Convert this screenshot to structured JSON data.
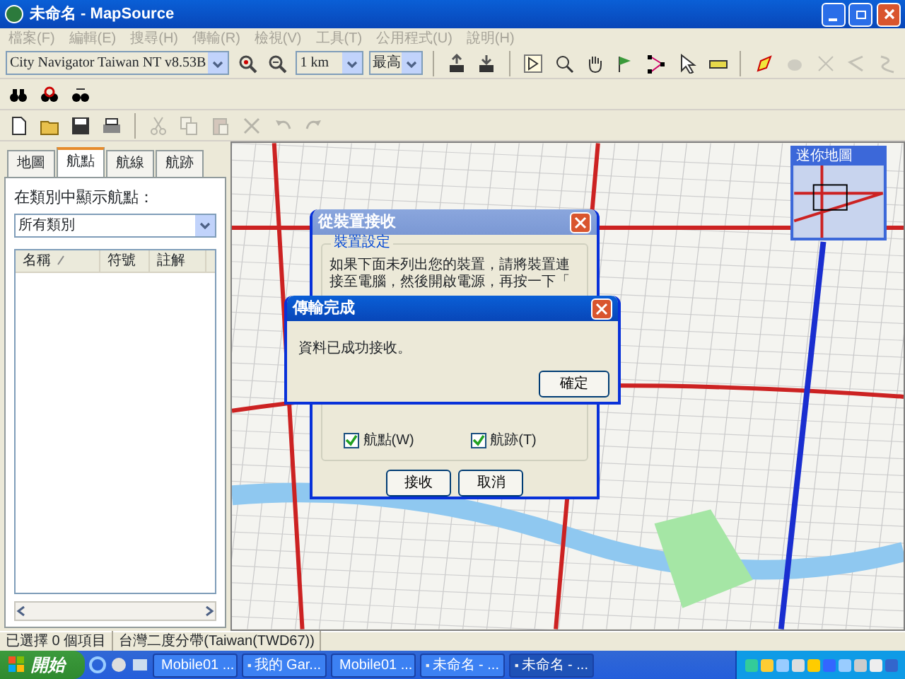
{
  "window": {
    "title": "未命名 - MapSource"
  },
  "menu": [
    {
      "label": "檔案(F)",
      "disabled": true
    },
    {
      "label": "編輯(E)",
      "disabled": true
    },
    {
      "label": "搜尋(H)",
      "disabled": true
    },
    {
      "label": "傳輸(R)",
      "disabled": true
    },
    {
      "label": "檢視(V)",
      "disabled": true
    },
    {
      "label": "工具(T)",
      "disabled": true
    },
    {
      "label": "公用程式(U)",
      "disabled": true
    },
    {
      "label": "說明(H)",
      "disabled": true
    }
  ],
  "map_toolbar": {
    "product": "City Navigator Taiwan NT v8.53B",
    "zoom": "1 km",
    "detail": "最高"
  },
  "edit_tools": {
    "disabled": true
  },
  "route_tools": {
    "disabled": true
  },
  "sidebar": {
    "tabs": [
      {
        "label": "地圖",
        "selected": false
      },
      {
        "label": "航點",
        "selected": true
      },
      {
        "label": "航線",
        "selected": false
      },
      {
        "label": "航跡",
        "selected": false
      }
    ],
    "category_label": "在類別中顯示航點：",
    "category": "所有類別",
    "columns": [
      "名稱",
      "符號",
      "註解"
    ]
  },
  "mini_map": {
    "title": "迷你地圖"
  },
  "receive_dialog": {
    "title": "從裝置接收",
    "group": "裝置設定",
    "text": "如果下面未列出您的裝置，請將裝置連接至電腦，然後開啟電源，再按一下「",
    "options": [
      {
        "label": "航點(W)",
        "checked": true
      },
      {
        "label": "航跡(T)",
        "checked": true
      }
    ],
    "buttons": [
      "接收",
      "取消"
    ]
  },
  "message_dialog": {
    "title": "傳輸完成",
    "message": "資料已成功接收。",
    "button": "確定"
  },
  "status_bar": [
    "已選擇 0 個項目",
    "台灣二度分帶(Taiwan(TWD67))"
  ],
  "taskbar": {
    "start": "開始",
    "tasks": [
      {
        "label": "Mobile01 ...",
        "selected": false
      },
      {
        "label": "我的 Gar...",
        "selected": false
      },
      {
        "label": "Mobile01 ...",
        "selected": false
      },
      {
        "label": "未命名 - ...",
        "selected": false
      },
      {
        "label": "未命名 - ...",
        "selected": true
      }
    ]
  }
}
